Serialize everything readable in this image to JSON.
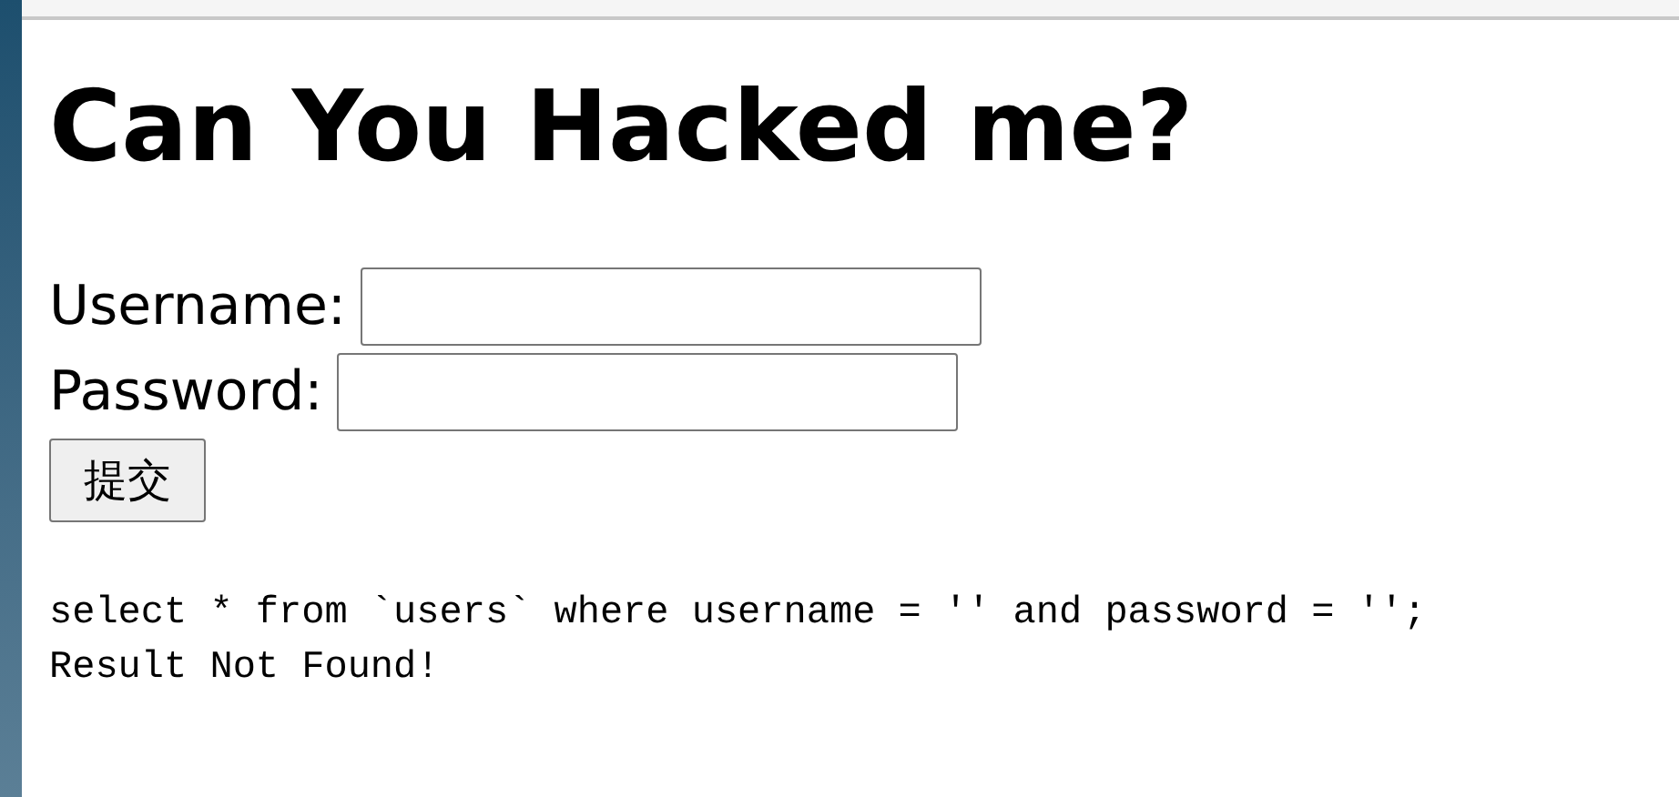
{
  "heading": "Can You Hacked me?",
  "form": {
    "fields": [
      {
        "label": "Username:"
      },
      {
        "label": "Password:"
      }
    ],
    "submit": "提交"
  },
  "output": [
    "select * from `users` where username = '' and password = '';",
    "Result Not Found!"
  ]
}
